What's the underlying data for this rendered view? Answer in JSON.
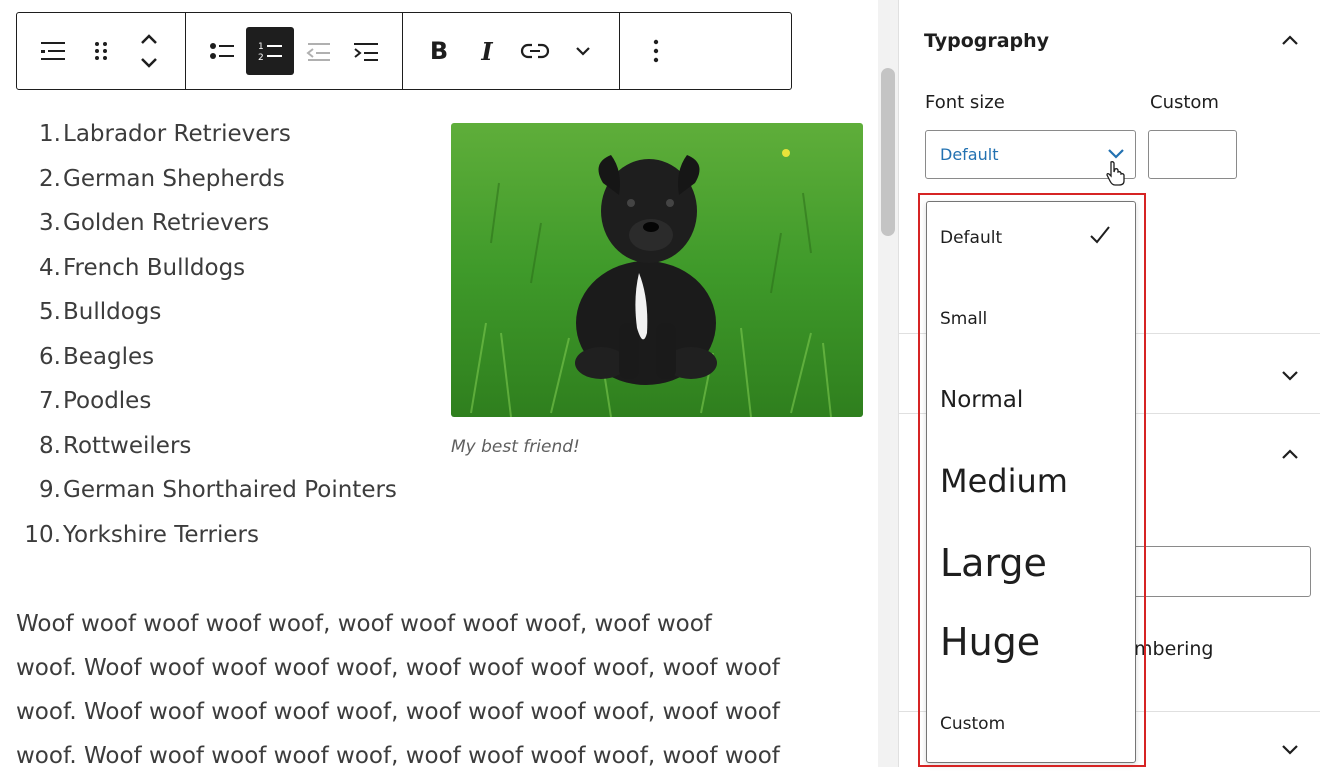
{
  "toolbar": {
    "groups": [
      [
        "list-icon",
        "drag-handle-icon",
        "move-up-down-icon"
      ],
      [
        "bullet-list-icon",
        "numbered-list-icon",
        "outdent-icon",
        "indent-icon"
      ],
      [
        "bold-icon",
        "italic-icon",
        "link-icon",
        "chevron-down-icon"
      ],
      [
        "more-options-icon"
      ]
    ],
    "bold_label": "B",
    "italic_label": "I"
  },
  "list": {
    "items": [
      {
        "num": "1.",
        "text": "Labrador Retrievers"
      },
      {
        "num": "2.",
        "text": "German Shepherds"
      },
      {
        "num": "3.",
        "text": "Golden Retrievers"
      },
      {
        "num": "4.",
        "text": "French Bulldogs"
      },
      {
        "num": "5.",
        "text": "Bulldogs"
      },
      {
        "num": "6.",
        "text": "Beagles"
      },
      {
        "num": "7.",
        "text": "Poodles"
      },
      {
        "num": "8.",
        "text": "Rottweilers"
      },
      {
        "num": "9.",
        "text": "German Shorthaired Pointers"
      },
      {
        "num": "10.",
        "text": "Yorkshire Terriers"
      }
    ]
  },
  "image": {
    "caption": "My best friend!"
  },
  "paragraph": {
    "lines": [
      "Woof woof woof woof woof, woof woof woof woof, woof woof",
      "woof. Woof woof woof woof woof, woof woof woof woof, woof woof",
      "woof. Woof woof woof woof woof, woof woof woof woof, woof woof",
      "woof. Woof woof woof woof woof, woof woof woof woof, woof woof"
    ]
  },
  "sidebar": {
    "typography_title": "Typography",
    "font_size_label": "Font size",
    "custom_label": "Custom",
    "selected_value": "Default",
    "numbering_fragment": "mbering"
  },
  "dropdown": {
    "options": [
      "Default",
      "Small",
      "Normal",
      "Medium",
      "Large",
      "Huge",
      "Custom"
    ],
    "selected": "Default"
  },
  "colors": {
    "accent": "#2271b1",
    "highlight": "#d62424",
    "text": "#1e1e1e"
  }
}
